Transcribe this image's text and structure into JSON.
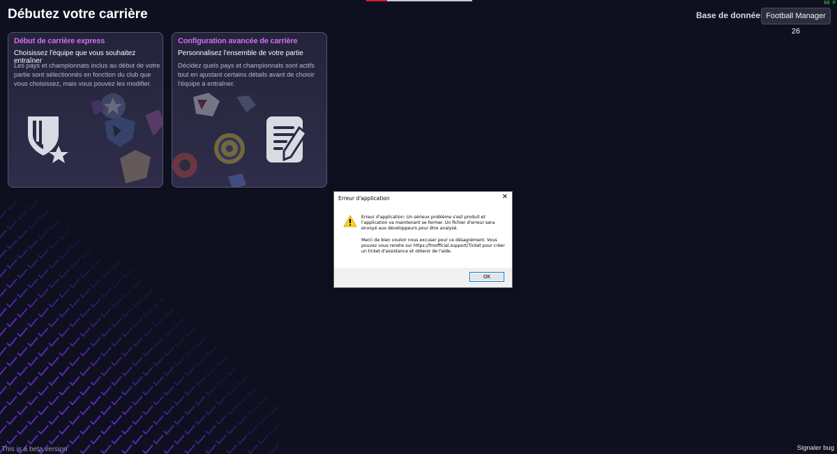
{
  "fps": "60 P",
  "page_title": "Débutez votre carrière",
  "database": {
    "label": "Base de données :",
    "selected": "Football Manager 26"
  },
  "cards": [
    {
      "title": "Début de carrière express",
      "subtitle": "Choisissez l'équipe que vous souhaitez entraîner",
      "description": "Les pays et championnats inclus au début de votre partie sont sélectionnés en fonction du club que vous choisissez, mais vous pouvez les modifier.",
      "icon": "shield-star-icon"
    },
    {
      "title": "Configuration avancée de carrière",
      "subtitle": "Personnalisez l'ensemble de votre partie",
      "description": "Décidez quels pays et championnats sont actifs tout en ajustant certains détails avant de choisir l'équipe à entraîner.",
      "icon": "document-pencil-icon"
    }
  ],
  "footer": {
    "beta_text": "This is a beta version",
    "report_bug": "Signaler bug"
  },
  "dialog": {
    "title": "Erreur d'application",
    "close": "✕",
    "message_1": "Erreur d'application: Un sérieux problème s'est produit et l'application va maintenant se fermer. Un fichier d'erreur sera envoyé aux développeurs pour être analysé.",
    "message_2": "Merci de bien vouloir nous excuser pour ce désagrément. Vous pouvez vous rendre sur https://fmofficial.support/Ticket pour créer un ticket d'assistance et obtenir de l'aide.",
    "ok_label": "OK",
    "icon": "warning-icon"
  },
  "colors": {
    "background": "#0e1020",
    "card_title": "#d46cf0",
    "pattern": "#6a2fd0"
  }
}
